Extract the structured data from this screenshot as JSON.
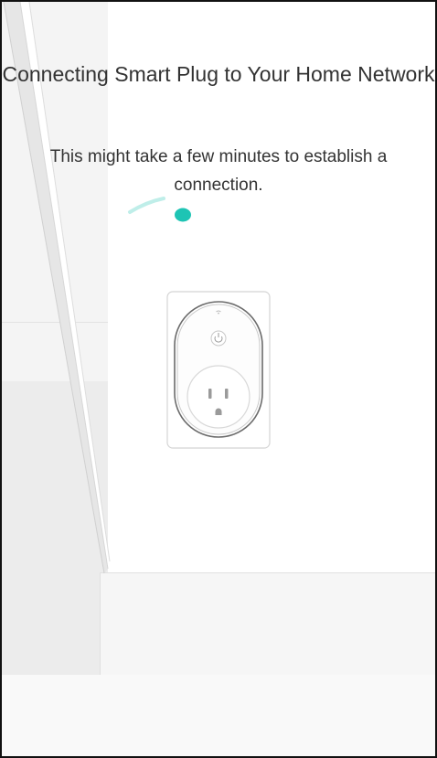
{
  "screen": {
    "title": "Connecting Smart Plug to Your Home Network",
    "subtitle": "This might take a few minutes to establish a connection."
  },
  "colors": {
    "accent": "#1ec4b4",
    "text": "#333333",
    "plug_outline": "#6b6b6b"
  },
  "icons": {
    "device": "smart-plug-icon",
    "progress": "connecting-spinner-icon",
    "wifi": "wifi-icon"
  }
}
